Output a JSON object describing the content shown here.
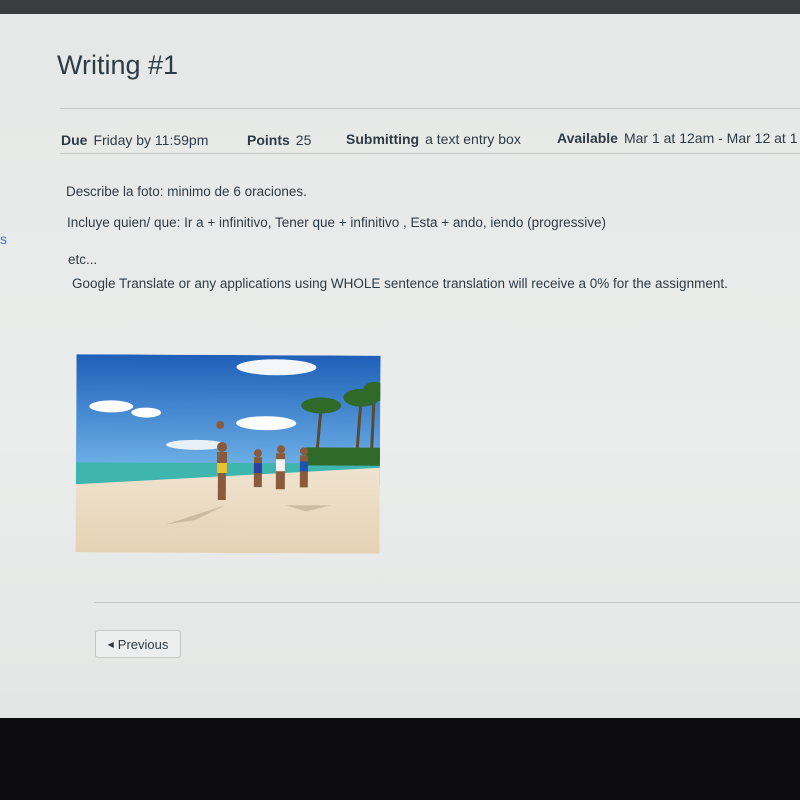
{
  "sidebar_fragment": "s",
  "assignment": {
    "title": "Writing #1",
    "due_label": "Due",
    "due_value": "Friday by 11:59pm",
    "points_label": "Points",
    "points_value": "25",
    "submitting_label": "Submitting",
    "submitting_value": "a text entry box",
    "available_label": "Available",
    "available_value": "Mar 1 at 12am - Mar 12 at 1"
  },
  "description": [
    "Describe la foto: minimo de 6 oraciones.",
    "Incluye quien/ que: Ir a + infinitivo, Tener que + infinitivo , Esta + ando, iendo (progressive)",
    "etc...",
    "Google Translate or any applications using WHOLE sentence translation will receive a 0% for the assignment."
  ],
  "nav": {
    "previous_label": "Previous",
    "previous_icon": "triangle-left-icon"
  },
  "colors": {
    "link": "#3b7bbf",
    "text": "#2d3b45"
  }
}
